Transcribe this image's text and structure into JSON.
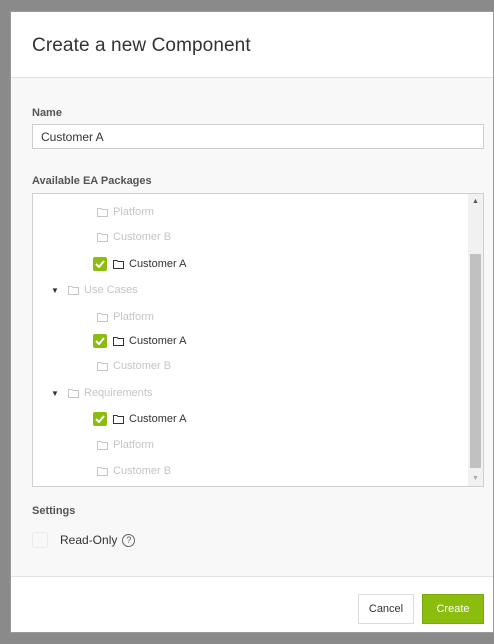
{
  "dialog": {
    "title": "Create a new Component",
    "name_label": "Name",
    "name_value": "Customer A",
    "packages_label": "Available EA Packages",
    "settings_label": "Settings",
    "readonly_label": "Read-Only",
    "help_glyph": "?",
    "cancel_label": "Cancel",
    "create_label": "Create"
  },
  "tree": [
    {
      "label": "Platform",
      "checked": false,
      "enabled": false,
      "expander": false
    },
    {
      "label": "Customer B",
      "checked": false,
      "enabled": false,
      "expander": false
    },
    {
      "label": "Customer A",
      "checked": true,
      "enabled": true,
      "expander": false
    },
    {
      "label": "Use Cases",
      "checked": false,
      "enabled": false,
      "expander": true
    },
    {
      "label": "Platform",
      "checked": false,
      "enabled": false,
      "expander": false
    },
    {
      "label": "Customer A",
      "checked": true,
      "enabled": true,
      "expander": false
    },
    {
      "label": "Customer B",
      "checked": false,
      "enabled": false,
      "expander": false
    },
    {
      "label": "Requirements",
      "checked": false,
      "enabled": false,
      "expander": true
    },
    {
      "label": "Customer A",
      "checked": true,
      "enabled": true,
      "expander": false
    },
    {
      "label": "Platform",
      "checked": false,
      "enabled": false,
      "expander": false
    },
    {
      "label": "Customer B",
      "checked": false,
      "enabled": false,
      "expander": false
    }
  ],
  "colors": {
    "accent": "#8bbd0e",
    "disabled_text": "#c5c5c5",
    "text": "#333333"
  },
  "icons": {
    "folder": "folder-icon",
    "check": "check-icon",
    "expand": "caret-down-icon",
    "help": "help-icon"
  }
}
